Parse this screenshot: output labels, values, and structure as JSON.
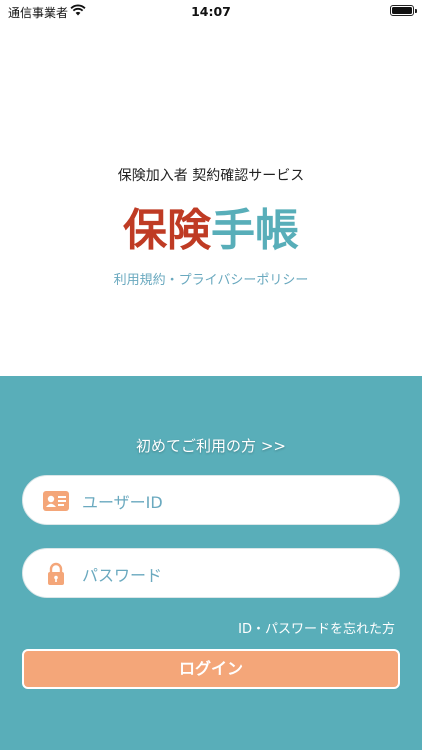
{
  "status_bar": {
    "carrier": "通信事業者",
    "time": "14:07",
    "wifi_icon": "wifi-icon",
    "battery_icon": "battery-icon"
  },
  "header": {
    "subtitle": "保険加入者 契約確認サービス",
    "brand_part1": "保険",
    "brand_part2": "手帳",
    "policy_link": "利用規約・プライバシーポリシー"
  },
  "login": {
    "first_time_link": "初めてご利用の方 >>",
    "user_id": {
      "placeholder": "ユーザーID",
      "value": "",
      "icon": "id-card-icon"
    },
    "password": {
      "placeholder": "パスワード",
      "value": "",
      "icon": "lock-icon"
    },
    "forgot_link": "ID・パスワードを忘れた方",
    "login_button": "ログイン"
  },
  "colors": {
    "brand_red": "#bf3b24",
    "brand_teal": "#58aeb9",
    "panel_bg": "#59aeb9",
    "accent_orange": "#f4a679",
    "link_blue": "#6aa9bf"
  }
}
